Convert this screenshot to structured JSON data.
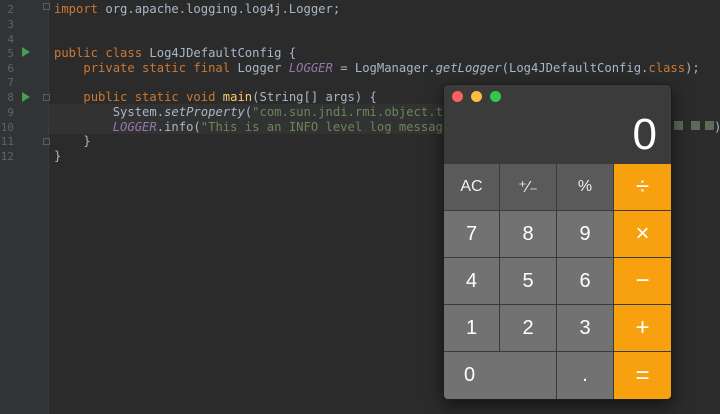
{
  "editor": {
    "line_numbers": [
      "2",
      "3",
      "4",
      "5",
      "6",
      "7",
      "8",
      "9",
      "10",
      "11",
      "12"
    ],
    "lines": [
      {
        "kw": "import ",
        "rest": "org.apache.logging.log4j.Logger;"
      },
      {
        "kw": "",
        "rest": ""
      },
      {
        "kw": "",
        "rest": ""
      },
      {
        "kw": "public class ",
        "rest": "Log4JDefaultConfig {"
      },
      {
        "pre": "    ",
        "kw": "private static final ",
        "type": "Logger ",
        "const": "LOGGER",
        "mid": " = LogManager.",
        "method": "getLogger",
        "tail": "(Log4JDefaultConfig.",
        "cls": "class",
        "end": ");"
      },
      {
        "kw": "",
        "rest": ""
      },
      {
        "pre": "    ",
        "kw": "public static void ",
        "name": "main",
        "rest": "(String[] args) {"
      },
      {
        "pre": "        ",
        "sys": "System.",
        "method": "setProperty",
        "open": "(",
        "str": "\"com.sun.jndi.rmi.object.trust"
      },
      {
        "pre": "        ",
        "const": "LOGGER",
        "mid": ".info(",
        "str": "\"This is an INFO level log message!"
      },
      {
        "pre": "    ",
        "rest": "}"
      },
      {
        "rest": "}"
      }
    ],
    "trailing_paren": ")"
  },
  "calculator": {
    "display": "0",
    "keys": {
      "ac": "AC",
      "plus_minus": "⁺∕₋",
      "percent": "%",
      "divide": "÷",
      "seven": "7",
      "eight": "8",
      "nine": "9",
      "multiply": "×",
      "four": "4",
      "five": "5",
      "six": "6",
      "minus": "−",
      "one": "1",
      "two": "2",
      "three": "3",
      "plus": "+",
      "zero": "0",
      "decimal": ".",
      "equals": "="
    },
    "colors": {
      "operator": "#f6a10d",
      "function": "#5a5a5a",
      "number": "#727272"
    }
  }
}
